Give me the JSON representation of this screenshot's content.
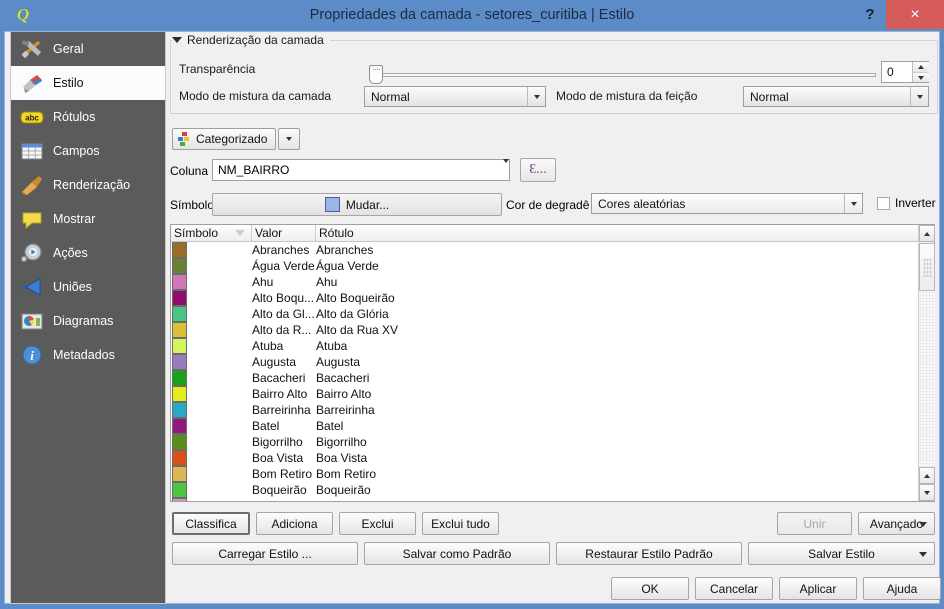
{
  "window": {
    "title": "Propriedades da camada - setores_curitiba | Estilo",
    "app_icon": "qgis-logo-icon",
    "help_label": "?",
    "close_label": "×"
  },
  "sidebar": {
    "items": [
      {
        "label": "Geral",
        "icon": "hammer-wrench-icon",
        "selected": false
      },
      {
        "label": "Estilo",
        "icon": "paint-brush-icon",
        "selected": true
      },
      {
        "label": "Rótulos",
        "icon": "abc-label-icon",
        "selected": false
      },
      {
        "label": "Campos",
        "icon": "table-grid-icon",
        "selected": false
      },
      {
        "label": "Renderização",
        "icon": "broom-icon",
        "selected": false
      },
      {
        "label": "Mostrar",
        "icon": "speech-bubble-icon",
        "selected": false
      },
      {
        "label": "Ações",
        "icon": "gear-play-icon",
        "selected": false
      },
      {
        "label": "Uniões",
        "icon": "join-arrow-icon",
        "selected": false
      },
      {
        "label": "Diagramas",
        "icon": "pie-chart-icon",
        "selected": false
      },
      {
        "label": "Metadados",
        "icon": "info-circle-icon",
        "selected": false
      }
    ]
  },
  "render_group": {
    "legend": "Renderização da camada",
    "collapse_icon": "triangle-down-icon",
    "transparency_label": "Transparência",
    "transparency_value": "0",
    "blend_layer_label": "Modo de mistura da camada",
    "blend_layer_value": "Normal",
    "blend_feature_label": "Modo de mistura da feição",
    "blend_feature_value": "Normal"
  },
  "renderer": {
    "label": "Categorizado",
    "icon": "categorized-renderer-icon",
    "dropdown_icon": "chevron-down-icon"
  },
  "column_row": {
    "label": "Coluna",
    "value": "NM_BAIRRO",
    "expression_button": "Ɛ...",
    "expression_icon": "epsilon-expression-icon"
  },
  "symbol_row": {
    "label": "Símbolo",
    "button_label": "Mudar...",
    "swatch_color": "#9cb4e8",
    "ramp_label": "Cor de degradê",
    "ramp_value": "Cores aleatórias",
    "invert_label": "Inverter",
    "invert_checked": false
  },
  "table": {
    "headers": [
      "Símbolo",
      "Valor",
      "Rótulo"
    ],
    "sort_indicator_column": "Símbolo",
    "rows": [
      {
        "color": "#9c6b29",
        "value": "Abranches",
        "label": "Abranches"
      },
      {
        "color": "#6b8037",
        "value": "Água Verde",
        "label": "Água Verde"
      },
      {
        "color": "#d177b4",
        "value": "Ahu",
        "label": "Ahu"
      },
      {
        "color": "#910d6b",
        "value": "Alto Boqu...",
        "label": "Alto Boqueirão"
      },
      {
        "color": "#49c583",
        "value": "Alto da Gl...",
        "label": "Alto da Glória"
      },
      {
        "color": "#d8c038",
        "value": "Alto da R...",
        "label": "Alto da Rua XV"
      },
      {
        "color": "#d3f55c",
        "value": "Atuba",
        "label": "Atuba"
      },
      {
        "color": "#9a79c2",
        "value": "Augusta",
        "label": "Augusta"
      },
      {
        "color": "#17a31c",
        "value": "Bacacheri",
        "label": "Bacacheri"
      },
      {
        "color": "#e6eb1c",
        "value": "Bairro Alto",
        "label": "Bairro Alto"
      },
      {
        "color": "#2aa8c9",
        "value": "Barreirinha",
        "label": "Barreirinha"
      },
      {
        "color": "#8e1a7e",
        "value": "Batel",
        "label": "Batel"
      },
      {
        "color": "#56901a",
        "value": "Bigorrilho",
        "label": "Bigorrilho"
      },
      {
        "color": "#d8501a",
        "value": "Boa Vista",
        "label": "Boa Vista"
      },
      {
        "color": "#ddb852",
        "value": "Bom Retiro",
        "label": "Bom Retiro"
      },
      {
        "color": "#4cc642",
        "value": "Boqueirão",
        "label": "Boqueirão"
      },
      {
        "color": "#d98fc4",
        "value": "",
        "label": ""
      }
    ]
  },
  "buttons": {
    "classifica": "Classifica",
    "adiciona": "Adiciona",
    "exclui": "Exclui",
    "exclui_tudo": "Exclui tudo",
    "unir": "Unir",
    "avancado": "Avançado",
    "carregar_estilo": "Carregar Estilo ...",
    "salvar_como_padrao": "Salvar como Padrão",
    "restaurar_estilo_padrao": "Restaurar Estilo Padrão",
    "salvar_estilo": "Salvar Estilo",
    "ok": "OK",
    "cancelar": "Cancelar",
    "aplicar": "Aplicar",
    "ajuda": "Ajuda"
  },
  "colors": {
    "titlebar": "#5b8cc8",
    "close_button": "#d65c5c",
    "sidebar_bg": "#5b5b5b",
    "sidebar_selected_bg": "#fbfbfb",
    "dialog_bg": "#f0f0f0"
  }
}
